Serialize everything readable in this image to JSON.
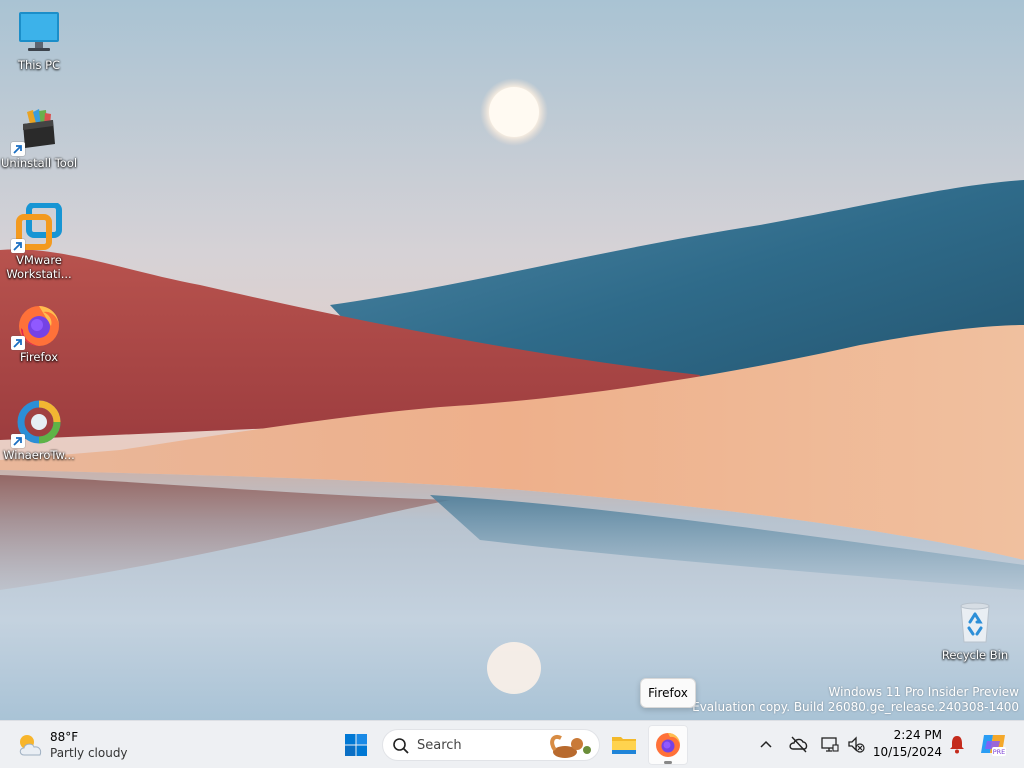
{
  "desktop": {
    "icons": [
      {
        "label": "This PC",
        "icon": "computer-icon"
      },
      {
        "label": "Uninstall Tool",
        "icon": "uninstall-tool-icon"
      },
      {
        "label": "VMware Workstati...",
        "icon": "vmware-icon"
      },
      {
        "label": "Firefox",
        "icon": "firefox-icon"
      },
      {
        "label": "WinaeroTw...",
        "icon": "winaero-tweaker-icon"
      },
      {
        "label": "Recycle Bin",
        "icon": "recycle-bin-icon"
      }
    ],
    "watermark": {
      "line1": "Windows 11 Pro Insider Preview",
      "line2": "Evaluation copy. Build 26080.ge_release.240308-1400"
    },
    "tooltip": "Firefox"
  },
  "taskbar": {
    "weather": {
      "temp": "88°F",
      "condition": "Partly cloudy",
      "icon": "partly-cloudy-icon"
    },
    "search_placeholder": "Search",
    "apps": [
      {
        "name": "Start",
        "icon": "windows-start-icon"
      },
      {
        "name": "File Explorer",
        "icon": "folder-icon"
      },
      {
        "name": "Firefox",
        "icon": "firefox-icon",
        "running": true
      }
    ],
    "tray": {
      "icons": [
        "chevron-up-icon",
        "onedrive-offline-icon",
        "network-icon",
        "volume-muted-icon",
        "notification-bell-icon",
        "copilot-icon"
      ],
      "time": "2:24 PM",
      "date": "10/15/2024"
    }
  },
  "colors": {
    "taskbar_bg": "#eef0f3",
    "windows_blue": "#0078d4",
    "notification_red": "#c42b1c"
  }
}
